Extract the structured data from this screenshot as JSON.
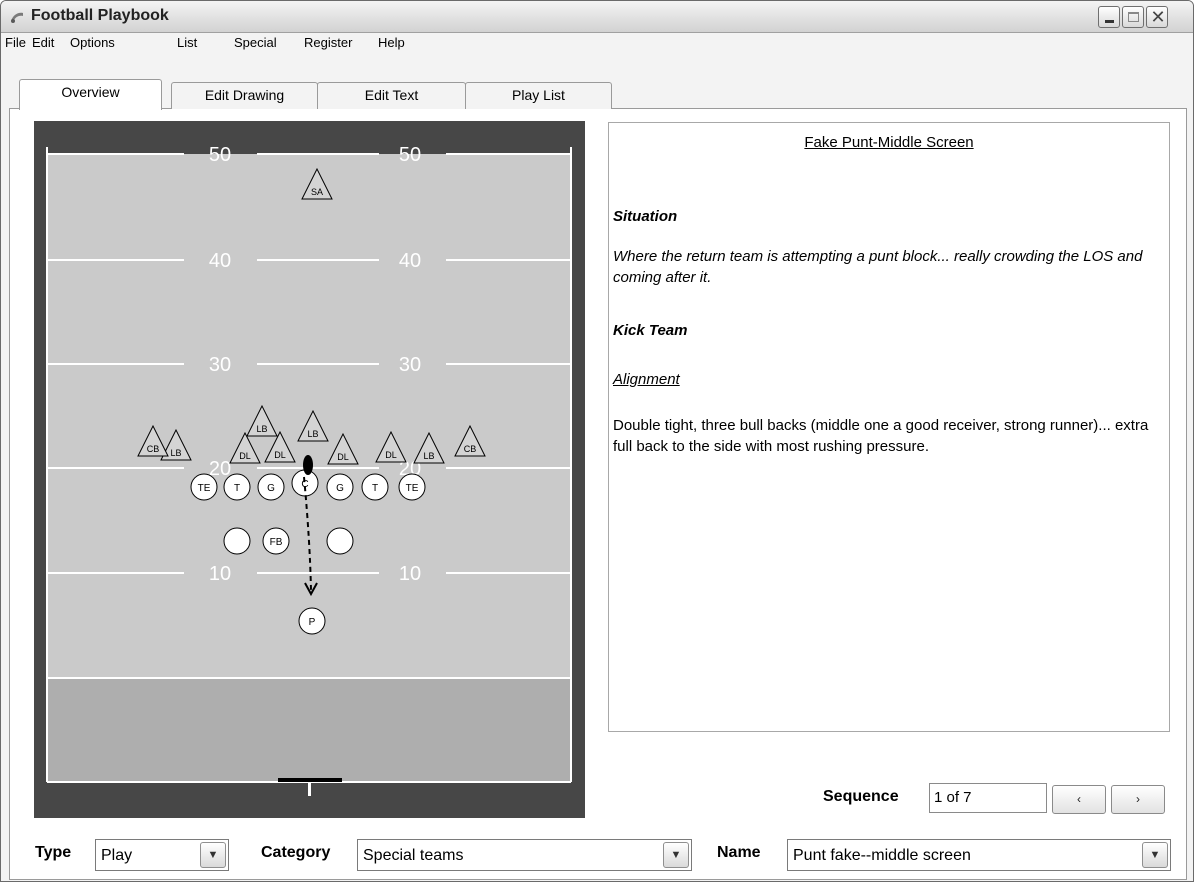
{
  "window": {
    "title": "Football Playbook",
    "controls": {
      "minimize": "_",
      "maximize": "",
      "close": "✕"
    }
  },
  "menu": [
    "File",
    "Edit",
    "Options",
    "List",
    "Special",
    "Register",
    "Help"
  ],
  "tabs": [
    "Overview",
    "Edit Drawing",
    "Edit Text",
    "Play List"
  ],
  "active_tab": "Overview",
  "field": {
    "yard_numbers": [
      "50",
      "40",
      "30",
      "20",
      "10"
    ],
    "defense": [
      "SA",
      "LB",
      "LB",
      "CB",
      "LB",
      "DL",
      "DL",
      "DL",
      "DL",
      "LB",
      "CB"
    ],
    "offense": [
      "TE",
      "T",
      "G",
      "C",
      "G",
      "T",
      "TE",
      "",
      "FB",
      "",
      "P"
    ],
    "colors": {
      "border": "#474747",
      "field": "#cacaca",
      "endzone": "#aeaeae",
      "lines": "#ffffff"
    }
  },
  "text": {
    "play_title": "Fake Punt-Middle Screen",
    "situation_heading": "Situation",
    "situation_body": "Where the return team is attempting a punt block... really crowding the LOS and coming after it.",
    "kick_team_heading": "Kick Team",
    "alignment_heading": "Alignment",
    "alignment_body": "Double tight, three bull backs (middle one a good receiver, strong runner)... extra full back to the side with most rushing pressure."
  },
  "sequence": {
    "label": "Sequence",
    "value": "1 of 7",
    "prev_icon": "‹",
    "next_icon": "›"
  },
  "bottom": {
    "type_label": "Type",
    "type_value": "Play",
    "category_label": "Category",
    "category_value": "Special teams",
    "name_label": "Name",
    "name_value": "Punt fake--middle screen",
    "dropdown_icon": "▼"
  }
}
